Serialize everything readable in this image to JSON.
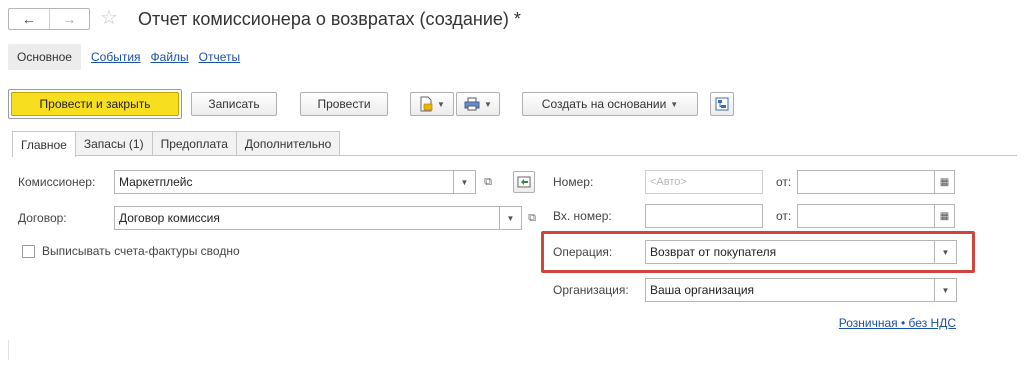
{
  "window": {
    "title": "Отчет комиссионера о возвратах (создание) *",
    "back_icon": "←",
    "forward_icon": "→",
    "favorite_icon": "☆"
  },
  "section_links": {
    "active": "Основное",
    "items": [
      "События",
      "Файлы",
      "Отчеты"
    ]
  },
  "toolbar": {
    "post_close_label": "Провести и закрыть",
    "save_label": "Записать",
    "post_label": "Провести",
    "create_based_label": "Создать на основании"
  },
  "tabs": [
    "Главное",
    "Запасы (1)",
    "Предоплата",
    "Дополнительно"
  ],
  "form": {
    "commissioner_label": "Комиссионер:",
    "commissioner_value": "Маркетплейс",
    "contract_label": "Договор:",
    "contract_value": "Договор комиссия",
    "invoice_checkbox_label": "Выписывать счета-фактуры сводно",
    "invoice_checkbox_checked": false,
    "number_label": "Номер:",
    "number_placeholder": "<Авто>",
    "date_label": "от:",
    "incoming_number_label": "Вх. номер:",
    "incoming_date_label": "от:",
    "operation_label": "Операция:",
    "operation_value": "Возврат от покупателя",
    "organization_label": "Организация:",
    "organization_value": "Ваша организация",
    "tax_link": "Розничная • без НДС"
  },
  "colors": {
    "primary_button": "#f7de1e",
    "highlight_frame": "#d0453b",
    "link": "#1a50a8"
  }
}
